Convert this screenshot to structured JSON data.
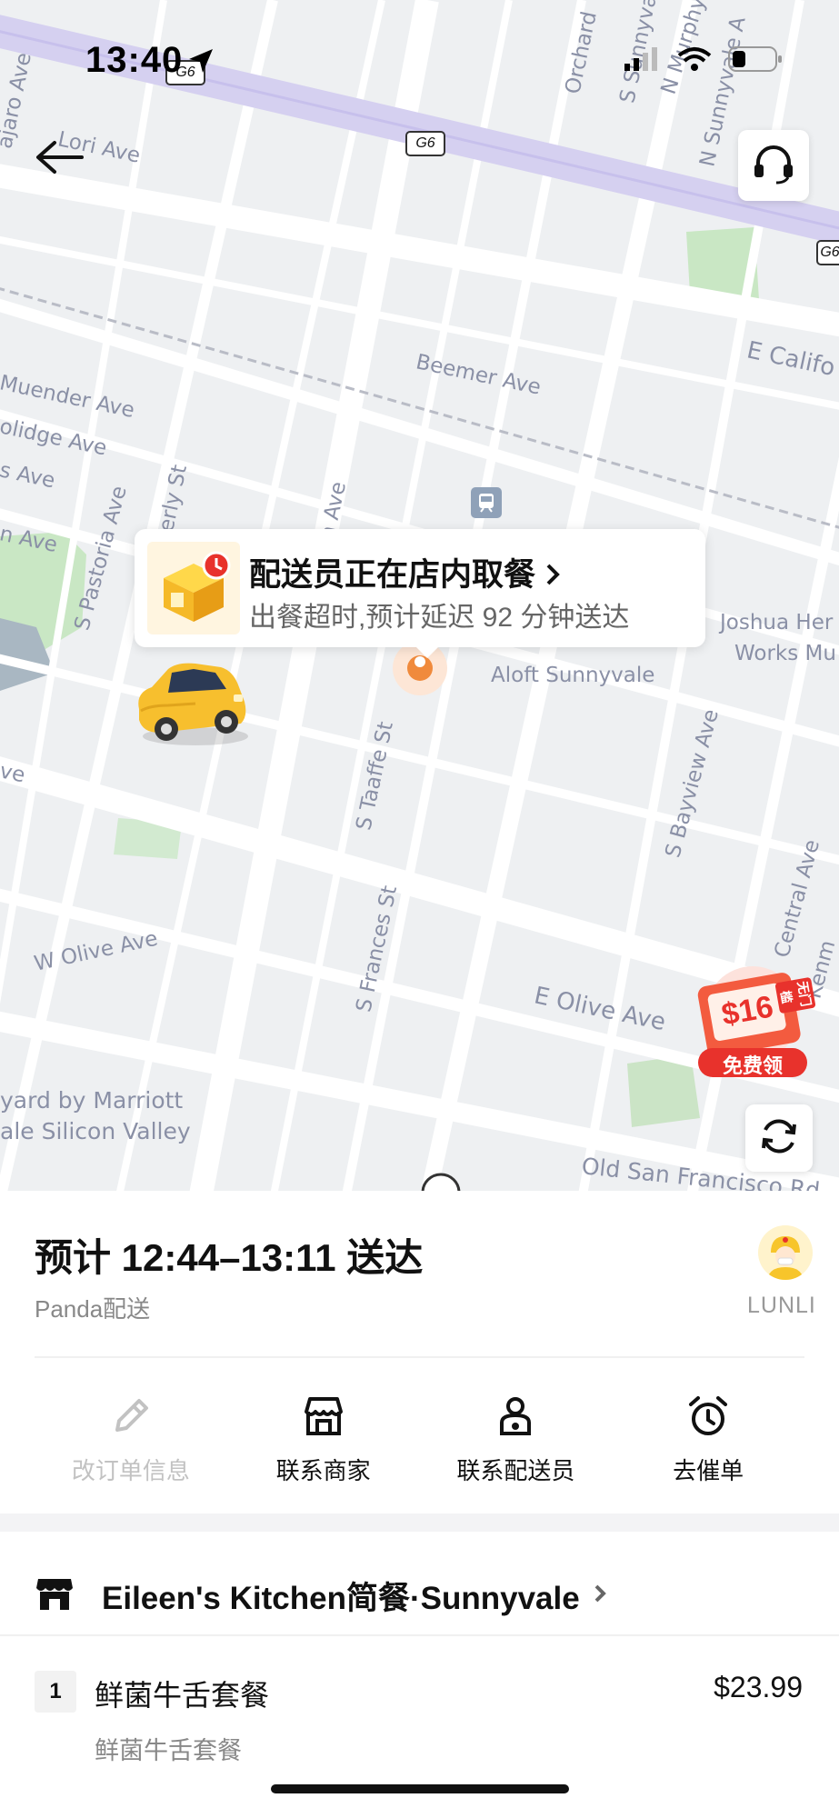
{
  "status_bar": {
    "time": "13:40"
  },
  "map": {
    "street_labels": [
      "Lori Ave",
      "Beemer Ave",
      "E Califo",
      "Muender Ave",
      "olidge Ave",
      "s Ave",
      "n Ave",
      "S Pastoria Ave",
      "verly St",
      "n Ave",
      "Joshua Her",
      "Works Mu",
      "Aloft Sunnyvale",
      "S Taaffe St",
      "S Bayview Ave",
      "W Olive Ave",
      "S Frances St",
      "E Olive Ave",
      "Central Ave",
      "Kenm",
      "yard by Marriott",
      "ale Silicon Valley",
      "Old San Francisco Rd",
      "Orchard",
      "S Sunnyvale Ave",
      "N Murphy",
      "N Sunnyvale A",
      "ajaro Ave",
      "ve"
    ],
    "highway_shields": [
      "G6",
      "G6",
      "G6"
    ]
  },
  "status_card": {
    "title": "配送员正在店内取餐",
    "subtitle": "出餐超时,预计延迟 92 分钟送达"
  },
  "promo": {
    "amount": "$16",
    "corner_text": "无门槛",
    "button_label": "免费领"
  },
  "order": {
    "eta": "预计 12:44–13:11 送达",
    "delivery_type": "Panda配送",
    "courier_name": "LUNLI"
  },
  "actions": [
    {
      "label": "改订单信息",
      "icon": "pencil-icon",
      "enabled": false
    },
    {
      "label": "联系商家",
      "icon": "store-icon",
      "enabled": true
    },
    {
      "label": "联系配送员",
      "icon": "courier-icon",
      "enabled": true
    },
    {
      "label": "去催单",
      "icon": "alarm-clock-icon",
      "enabled": true
    }
  ],
  "store": {
    "name": "Eileen's Kitchen简餐·Sunnyvale"
  },
  "items": [
    {
      "qty": "1",
      "name": "鲜菌牛舌套餐",
      "price": "$23.99",
      "desc": "鲜菌牛舌套餐"
    }
  ],
  "colors": {
    "map_bg": "#eef0f2",
    "highway": "#d5d0f0",
    "accent": "#f5a623",
    "promo_red": "#e8322c"
  }
}
